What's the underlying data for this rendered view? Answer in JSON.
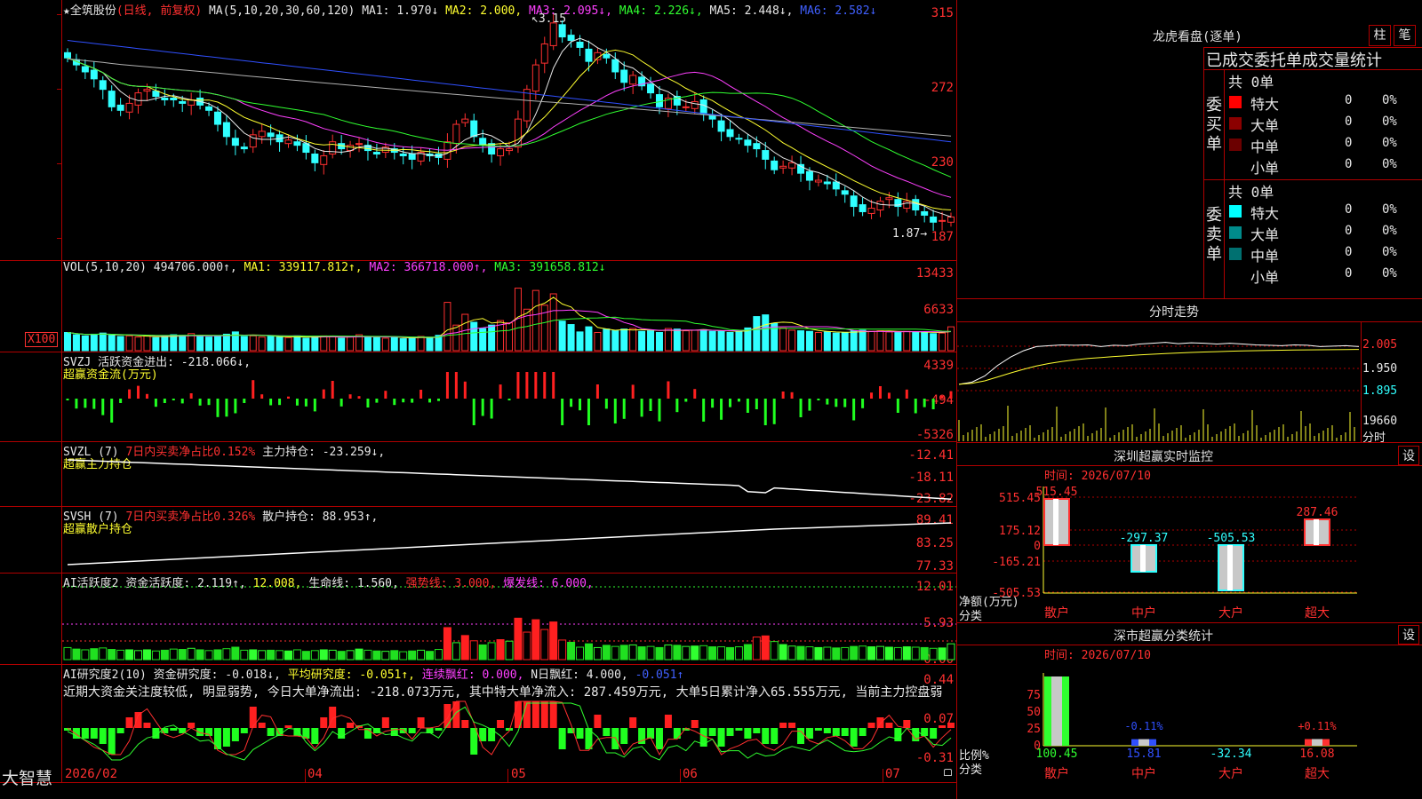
{
  "stock": {
    "name": "全筑股份",
    "period": "(日线, 前复权)",
    "star": "★"
  },
  "main_header": {
    "ma_label": "MA(5,10,20,30,60,120)",
    "ma1": "MA1: 1.970↓",
    "ma2": "MA2: 2.000,",
    "ma3": "MA3: 2.095↓,",
    "ma4": "MA4: 2.226↓,",
    "ma5": "MA5: 2.448↓,",
    "ma6": "MA6: 2.582↓"
  },
  "price_axis": [
    "315",
    "272",
    "230",
    "187"
  ],
  "price_notes": {
    "high": "3.15",
    "low": "1.87"
  },
  "vol_header": {
    "label": "VOL(5,10,20)",
    "value": "494706.000↑,",
    "ma1": "MA1: 339117.812↑,",
    "ma2": "MA2: 366718.000↑,",
    "ma3": "MA3: 391658.812↓"
  },
  "vol_axis": [
    "13433",
    "6633"
  ],
  "vol_unit": "X100",
  "svzj_header": {
    "label": "SVZJ",
    "text": "活跃资金进出: -218.066↓,",
    "sub": "超赢资金流(万元)"
  },
  "svzj_axis": [
    "4339",
    "-494",
    "-5326"
  ],
  "svzl_header": {
    "label": "SVZL (7)",
    "ratio": "7日内买卖净占比0.152%",
    "text": "主力持仓: -23.259↓,",
    "sub": "超赢主力持仓"
  },
  "svzl_axis": [
    "-12.41",
    "-18.11",
    "-23.82"
  ],
  "svsh_header": {
    "label": "SVSH (7)",
    "ratio": "7日内买卖净占比0.326%",
    "text": "散户持仓: 88.953↑,",
    "sub": "超赢散户持仓"
  },
  "svsh_axis": [
    "89.41",
    "83.25",
    "77.33"
  ],
  "ai1_header": {
    "label": "AI活跃度2",
    "a": "资金活跃度: 2.119↑,",
    "b": "12.008,",
    "c": "生命线: 1.560,",
    "d": "强势线: 3.000,",
    "e": "爆发线: 6.000,"
  },
  "ai1_axis": [
    "12.01",
    "5.93",
    "0.00"
  ],
  "ai2_header": {
    "label": "AI研究度2(10)",
    "a": "资金研究度: -0.018↓,",
    "b": "平均研究度: -0.051↑,",
    "c": "连续飘红: 0.000,",
    "d": "N日飘红: 4.000,",
    "e": "-0.051↑"
  },
  "ai2_text": "近期大资金关注度较低, 明显弱势, 今日大单净流出: -218.073万元, 其中特大单净流入: 287.459万元, 大单5日累计净入65.555万元, 当前主力控盘弱",
  "ai2_axis": [
    "0.44",
    "0.07",
    "-0.31"
  ],
  "time_axis": [
    "2026/02",
    "04",
    "05",
    "06",
    "07"
  ],
  "logo": "大智慧",
  "right_panel": {
    "title": "龙虎看盘(逐单)",
    "btn_zhu": "柱",
    "btn_bi": "笔",
    "subtitle": "已成交委托单成交量统计",
    "buy": {
      "label_chars": [
        "委",
        "买",
        "单"
      ],
      "total": "共 0单",
      "rows": [
        {
          "label": "特大",
          "n": "0",
          "p": "0%",
          "color": "#ff0000"
        },
        {
          "label": "大单",
          "n": "0",
          "p": "0%",
          "color": "#8b0000"
        },
        {
          "label": "中单",
          "n": "0",
          "p": "0%",
          "color": "#6b0000"
        },
        {
          "label": "小单",
          "n": "0",
          "p": "0%",
          "color": "#000000"
        }
      ]
    },
    "sell": {
      "label_chars": [
        "委",
        "卖",
        "单"
      ],
      "total": "共 0单",
      "rows": [
        {
          "label": "特大",
          "n": "0",
          "p": "0%",
          "color": "#00ffff"
        },
        {
          "label": "大单",
          "n": "0",
          "p": "0%",
          "color": "#008b8b"
        },
        {
          "label": "中单",
          "n": "0",
          "p": "0%",
          "color": "#007070"
        },
        {
          "label": "小单",
          "n": "0",
          "p": "0%",
          "color": "#000000"
        }
      ]
    },
    "intraday": {
      "title": "分时走势",
      "axis": [
        "2.005",
        "1.950",
        "1.895",
        "19660"
      ],
      "unit": "分时"
    },
    "monitor": {
      "title": "深圳超赢实时监控",
      "btn": "设",
      "time": "时间: 2026/07/10",
      "axis": [
        "515.45",
        "175.12",
        "0",
        "-165.21",
        "-505.53"
      ],
      "ylabel": "净额(万元)",
      "xlabel": "分类",
      "cats": [
        "散户",
        "中户",
        "大户",
        "超大"
      ],
      "values": [
        515.45,
        -297.37,
        -505.53,
        287.46
      ],
      "labels": [
        "515.45",
        "-297.37",
        "-505.53",
        "287.46"
      ]
    },
    "classify": {
      "title": "深市超赢分类统计",
      "btn": "设",
      "time": "时间: 2026/07/10",
      "axis": [
        "75",
        "50",
        "25",
        "0"
      ],
      "ylabel": "比例%",
      "xlabel": "分类",
      "cats": [
        "散户",
        "中户",
        "大户",
        "超大"
      ],
      "values": [
        100.45,
        15.81,
        -32.34,
        16.08
      ],
      "bottom_labels": [
        "100.45",
        "15.81",
        "-32.34",
        "16.08"
      ],
      "top_labels": [
        "",
        "-0.11%",
        "",
        "+0.11%"
      ]
    }
  },
  "chart_data": {
    "type": "candlestick",
    "title": "全筑股份",
    "x_ticks": [
      "2026/02",
      "04",
      "05",
      "06",
      "07"
    ],
    "ylim": [
      1.87,
      3.15
    ],
    "close": [
      2.9,
      2.86,
      2.82,
      2.78,
      2.72,
      2.62,
      2.6,
      2.64,
      2.7,
      2.72,
      2.68,
      2.66,
      2.66,
      2.64,
      2.66,
      2.63,
      2.6,
      2.52,
      2.45,
      2.4,
      2.38,
      2.46,
      2.48,
      2.45,
      2.42,
      2.43,
      2.4,
      2.36,
      2.3,
      2.34,
      2.42,
      2.38,
      2.4,
      2.41,
      2.37,
      2.35,
      2.39,
      2.36,
      2.34,
      2.32,
      2.36,
      2.34,
      2.33,
      2.42,
      2.52,
      2.55,
      2.45,
      2.4,
      2.35,
      2.38,
      2.38,
      2.55,
      2.72,
      2.86,
      2.98,
      3.1,
      3.02,
      3.0,
      2.96,
      2.88,
      2.93,
      2.9,
      2.82,
      2.76,
      2.8,
      2.74,
      2.7,
      2.62,
      2.67,
      2.63,
      2.62,
      2.65,
      2.58,
      2.55,
      2.48,
      2.45,
      2.44,
      2.4,
      2.38,
      2.32,
      2.26,
      2.28,
      2.3,
      2.24,
      2.2,
      2.2,
      2.18,
      2.15,
      2.12,
      2.05,
      2.02,
      2.04,
      2.08,
      2.1,
      2.05,
      2.08,
      2.03,
      2.0,
      1.96,
      1.97,
      1.99
    ],
    "volume": [
      3200,
      2800,
      2600,
      2900,
      3100,
      2700,
      2500,
      2600,
      2400,
      2600,
      2300,
      2500,
      2800,
      2700,
      3000,
      2600,
      2400,
      2600,
      2900,
      3300,
      2500,
      2600,
      2400,
      2500,
      2400,
      2300,
      2600,
      2200,
      2400,
      2600,
      2500,
      2200,
      2400,
      2800,
      2500,
      2300,
      2200,
      2400,
      2100,
      2300,
      2500,
      2200,
      2700,
      8500,
      4500,
      6400,
      5000,
      3900,
      4500,
      5300,
      4900,
      11000,
      7300,
      10600,
      8000,
      10000,
      5200,
      4600,
      3300,
      4200,
      3200,
      3800,
      3500,
      3800,
      3900,
      3400,
      3500,
      3200,
      3900,
      3800,
      3500,
      3600,
      3700,
      3400,
      3400,
      3200,
      3400,
      4000,
      6000,
      6300,
      4800,
      4000,
      3600,
      3500,
      3400,
      3200,
      3300,
      3100,
      3200,
      3500,
      3600,
      3400,
      3500,
      3300,
      3200,
      3400,
      3300,
      3200,
      3000,
      3100,
      4200
    ],
    "intraday_price": [
      1.91,
      1.915,
      1.93,
      1.955,
      1.975,
      1.99,
      2.0,
      2.002,
      2.004,
      2.003,
      2.004,
      2.0,
      2.003,
      2.002,
      2.006,
      2.008,
      2.01,
      2.007,
      2.009,
      2.008,
      2.006,
      2.008,
      2.006,
      2.004,
      2.003,
      2.002,
      2.004,
      2.003,
      2.0,
      2.001,
      2.002,
      2.0
    ]
  }
}
